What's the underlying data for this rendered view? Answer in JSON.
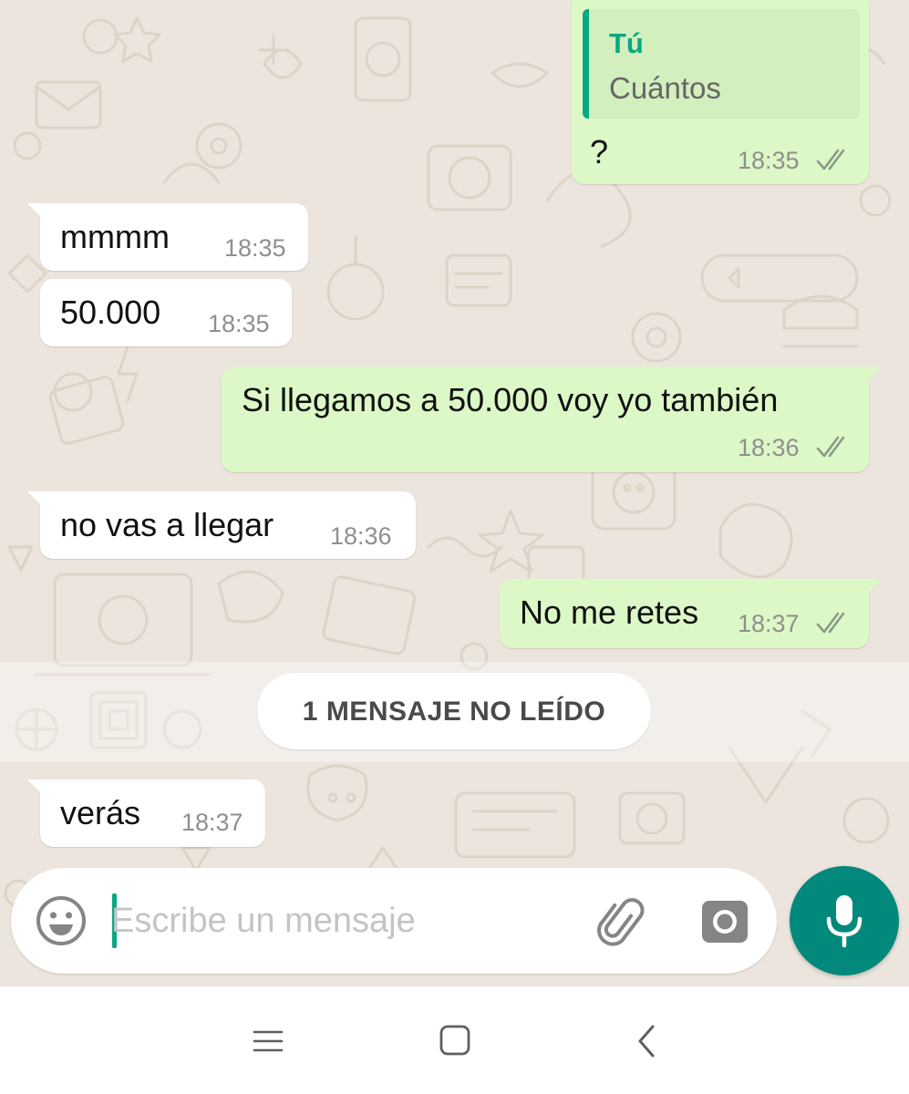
{
  "messages": [
    {
      "direction": "outgoing",
      "quote": {
        "author": "Tú",
        "text": "Cuántos"
      },
      "text": "?",
      "time": "18:35",
      "status": "read-double-check"
    },
    {
      "direction": "incoming",
      "text": "mmmm",
      "time": "18:35"
    },
    {
      "direction": "incoming",
      "text": "50.000",
      "time": "18:35"
    },
    {
      "direction": "outgoing",
      "text": "Si llegamos a 50.000 voy yo también",
      "time": "18:36",
      "status": "read-double-check"
    },
    {
      "direction": "incoming",
      "text": "no vas a llegar",
      "time": "18:36"
    },
    {
      "direction": "outgoing",
      "text": "No me retes",
      "time": "18:37",
      "status": "read-double-check"
    },
    {
      "direction": "incoming",
      "text": "verás",
      "time": "18:37"
    }
  ],
  "unread_divider": {
    "label": "1 MENSAJE NO LEÍDO"
  },
  "composer": {
    "placeholder": "Escribe un mensaje",
    "value": "",
    "icons": [
      "emoji-icon",
      "paperclip-icon",
      "camera-icon",
      "microphone-icon"
    ]
  },
  "navigation_bar": {
    "icons": [
      "menu-icon",
      "home-icon",
      "back-icon"
    ]
  },
  "colors": {
    "chat_background": "#ece5dd",
    "incoming_bubble": "#ffffff",
    "outgoing_bubble": "#dcf8c6",
    "accent": "#07a884",
    "mic_button": "#03897b",
    "read_ticks": "#8a9a8a"
  }
}
